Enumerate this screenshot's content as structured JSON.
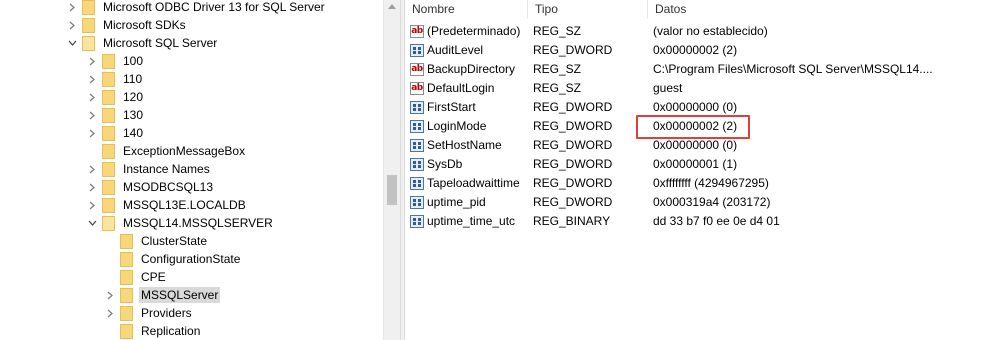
{
  "tree": {
    "items": [
      {
        "label": "Microsoft ODBC Driver 13 for SQL Server",
        "expander": "collapsed"
      },
      {
        "label": "Microsoft SDKs",
        "expander": "collapsed"
      },
      {
        "label": "Microsoft SQL Server",
        "expander": "expanded"
      },
      {
        "label": "100",
        "expander": "collapsed"
      },
      {
        "label": "110",
        "expander": "collapsed"
      },
      {
        "label": "120",
        "expander": "collapsed"
      },
      {
        "label": "130",
        "expander": "collapsed"
      },
      {
        "label": "140",
        "expander": "collapsed"
      },
      {
        "label": "ExceptionMessageBox",
        "expander": "none"
      },
      {
        "label": "Instance Names",
        "expander": "collapsed"
      },
      {
        "label": "MSODBCSQL13",
        "expander": "collapsed"
      },
      {
        "label": "MSSQL13E.LOCALDB",
        "expander": "collapsed"
      },
      {
        "label": "MSSQL14.MSSQLSERVER",
        "expander": "expanded"
      },
      {
        "label": "ClusterState",
        "expander": "none"
      },
      {
        "label": "ConfigurationState",
        "expander": "none"
      },
      {
        "label": "CPE",
        "expander": "none"
      },
      {
        "label": "MSSQLServer",
        "expander": "collapsed",
        "selected": true
      },
      {
        "label": "Providers",
        "expander": "collapsed"
      },
      {
        "label": "Replication",
        "expander": "none"
      }
    ]
  },
  "values_pane": {
    "headers": {
      "name": "Nombre",
      "type": "Tipo",
      "data": "Datos"
    },
    "rows": [
      {
        "icon": "string-value-icon",
        "name": "(Predeterminado)",
        "type": "REG_SZ",
        "data": "(valor no establecido)"
      },
      {
        "icon": "binary-value-icon",
        "name": "AuditLevel",
        "type": "REG_DWORD",
        "data": "0x00000002 (2)"
      },
      {
        "icon": "string-value-icon",
        "name": "BackupDirectory",
        "type": "REG_SZ",
        "data": "C:\\Program Files\\Microsoft SQL Server\\MSSQL14...."
      },
      {
        "icon": "string-value-icon",
        "name": "DefaultLogin",
        "type": "REG_SZ",
        "data": "guest"
      },
      {
        "icon": "binary-value-icon",
        "name": "FirstStart",
        "type": "REG_DWORD",
        "data": "0x00000000 (0)"
      },
      {
        "icon": "binary-value-icon",
        "name": "LoginMode",
        "type": "REG_DWORD",
        "data": "0x00000002 (2)",
        "highlighted": true
      },
      {
        "icon": "binary-value-icon",
        "name": "SetHostName",
        "type": "REG_DWORD",
        "data": "0x00000000 (0)"
      },
      {
        "icon": "binary-value-icon",
        "name": "SysDb",
        "type": "REG_DWORD",
        "data": "0x00000001 (1)"
      },
      {
        "icon": "binary-value-icon",
        "name": "Tapeloadwaittime",
        "type": "REG_DWORD",
        "data": "0xffffffff (4294967295)"
      },
      {
        "icon": "binary-value-icon",
        "name": "uptime_pid",
        "type": "REG_DWORD",
        "data": "0x000319a4 (203172)"
      },
      {
        "icon": "binary-value-icon",
        "name": "uptime_time_utc",
        "type": "REG_BINARY",
        "data": "dd 33 b7 f0 ee 0e d4 01"
      }
    ],
    "string_icon_glyph": "ab"
  },
  "colors": {
    "highlight_border": "#e0403a",
    "folder": "#f7d77a",
    "selected_bg": "#d9d9d9"
  }
}
